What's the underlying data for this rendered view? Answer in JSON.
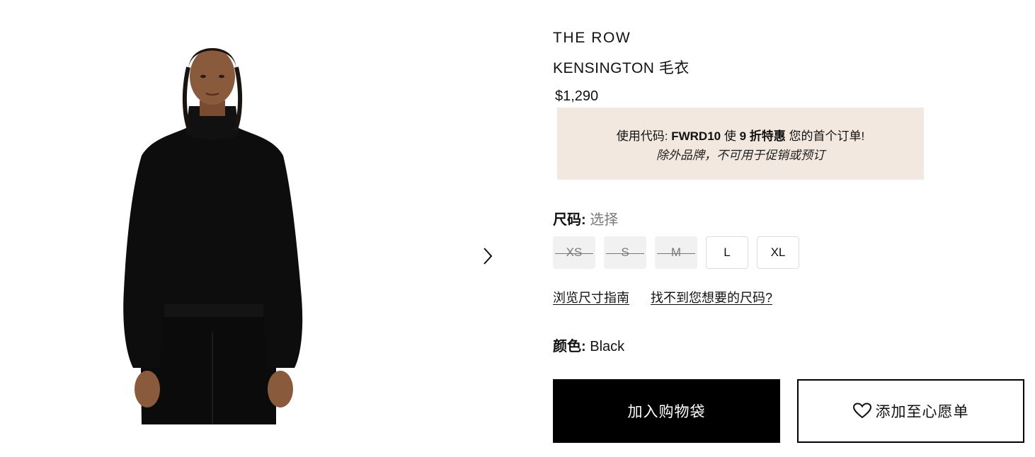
{
  "product": {
    "brand": "THE ROW",
    "name": "KENSINGTON 毛衣",
    "price": "$1,290",
    "image_alt": "Black turtleneck sweater worn by model"
  },
  "promo": {
    "prefix": "使用代码: ",
    "code": "FWRD10",
    "middle": " 使 ",
    "discount": "9 折特惠",
    "suffix": " 您的首个订单!",
    "note": "除外品牌，不可用于促销或预订"
  },
  "size": {
    "label": "尺码:",
    "placeholder": "选择",
    "options": [
      {
        "label": "XS",
        "available": false
      },
      {
        "label": "S",
        "available": false
      },
      {
        "label": "M",
        "available": false
      },
      {
        "label": "L",
        "available": true
      },
      {
        "label": "XL",
        "available": true
      }
    ],
    "guide_link": "浏览尺寸指南",
    "missing_size_link": "找不到您想要的尺码?"
  },
  "color": {
    "label": "颜色:",
    "value": "Black"
  },
  "actions": {
    "add_to_bag": "加入购物袋",
    "add_to_wishlist": "添加至心愿单"
  },
  "icons": {
    "next": "chevron-right-icon",
    "wishlist": "heart-icon"
  },
  "colors": {
    "promo_bg": "#f3e8e0",
    "primary_button": "#000000",
    "muted_text": "#7a7a7a"
  }
}
